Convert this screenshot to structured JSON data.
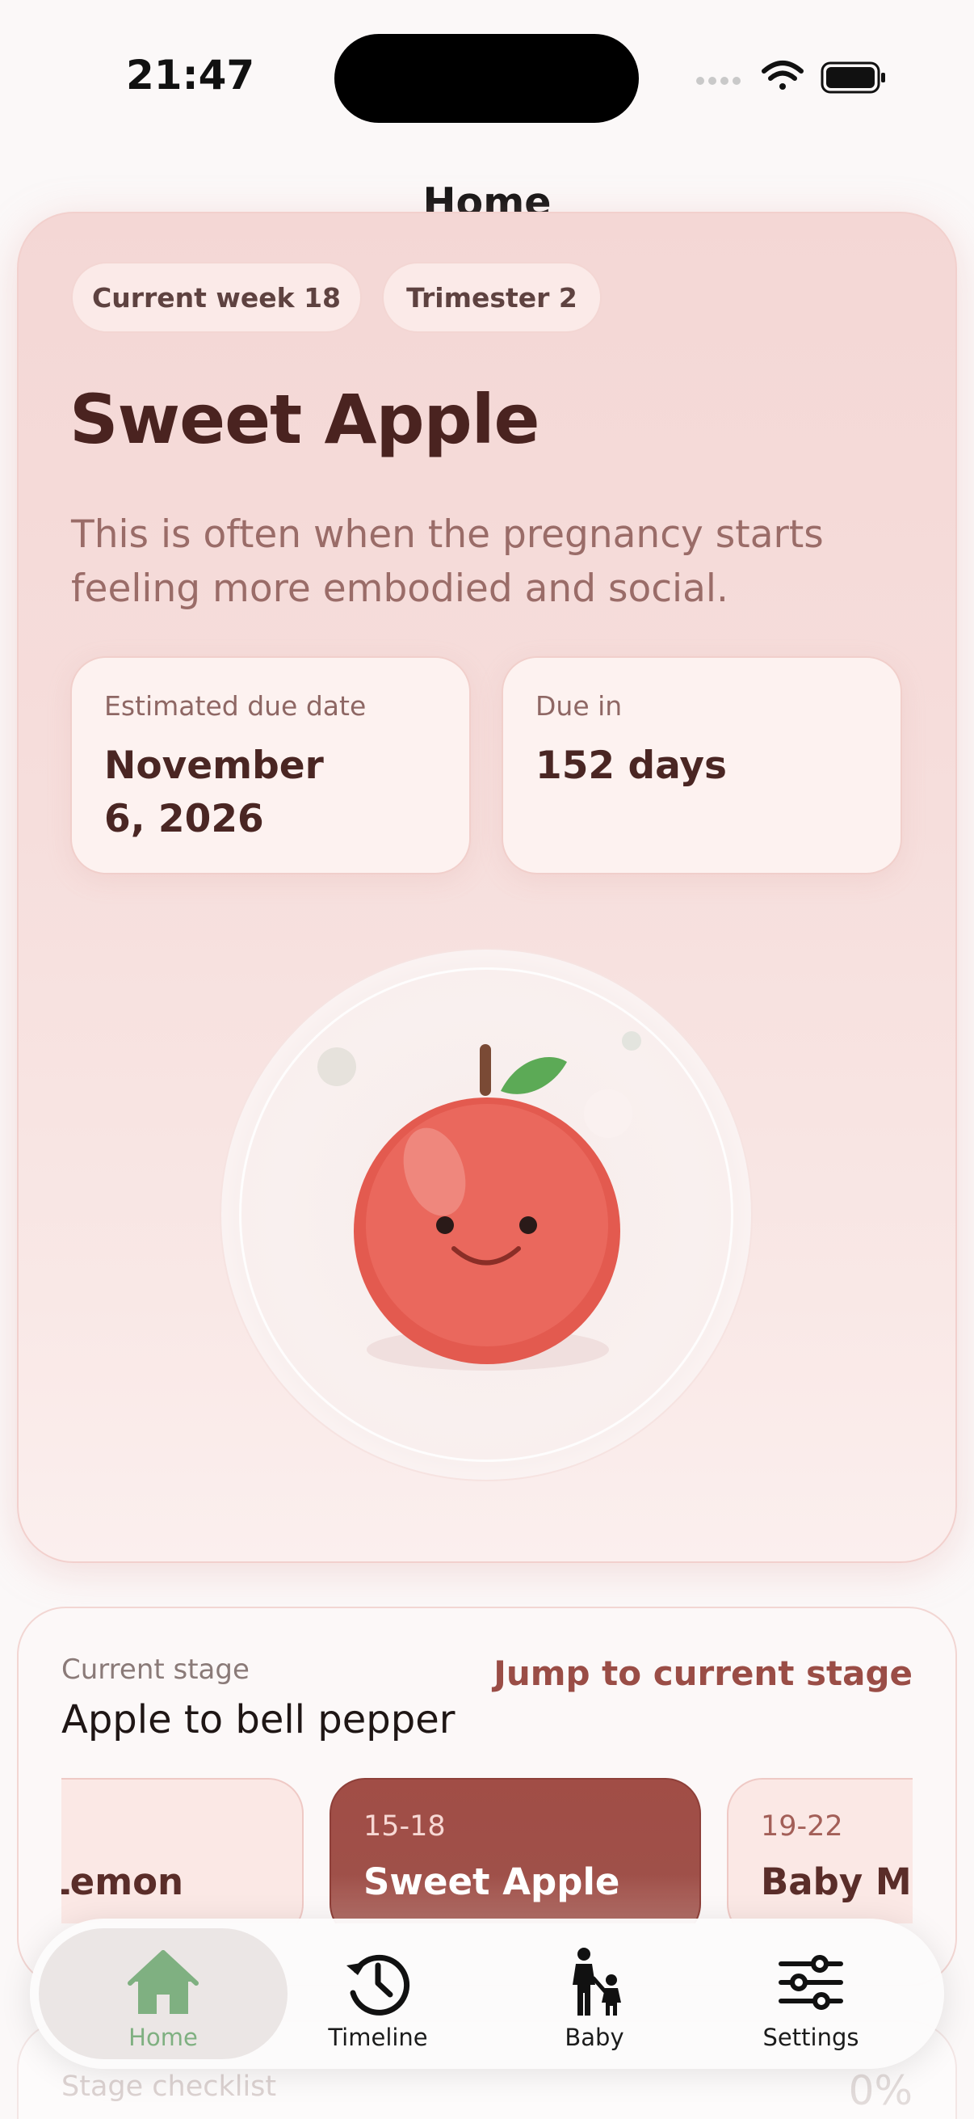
{
  "status_bar": {
    "time": "21:47",
    "icons": [
      "cellular-icon",
      "wifi-icon",
      "battery-icon"
    ]
  },
  "nav": {
    "title": "Home"
  },
  "hero": {
    "chips": {
      "week": "Current week 18",
      "trimester": "Trimester 2"
    },
    "title": "Sweet Apple",
    "description": "This is often when the pregnancy starts feeling more embodied and social.",
    "due_date": {
      "label": "Estimated due date",
      "value_line1": "November",
      "value_line2": "6, 2026"
    },
    "due_in": {
      "label": "Due in",
      "value": "152 days"
    },
    "illustration": "smiling-apple-icon"
  },
  "stage": {
    "label": "Current stage",
    "value": "Apple to bell pepper",
    "jump_link": "Jump to current stage",
    "items": [
      {
        "range": "",
        "name": "Lemon",
        "selected": false
      },
      {
        "range": "15-18",
        "name": "Sweet Apple",
        "selected": true
      },
      {
        "range": "19-22",
        "name": "Baby Mango",
        "selected": false
      }
    ]
  },
  "checklist": {
    "label": "Stage checklist",
    "percent": "0%"
  },
  "tabs": [
    {
      "label": "Home",
      "icon": "home-icon",
      "active": true
    },
    {
      "label": "Timeline",
      "icon": "history-clock-icon",
      "active": false
    },
    {
      "label": "Baby",
      "icon": "parent-child-icon",
      "active": false
    },
    {
      "label": "Settings",
      "icon": "sliders-icon",
      "active": false
    }
  ],
  "colors": {
    "accent": "#9a4d46",
    "hero_title": "#4a2320",
    "active_tab": "#7fb081",
    "apple_red": "#e8675c"
  }
}
